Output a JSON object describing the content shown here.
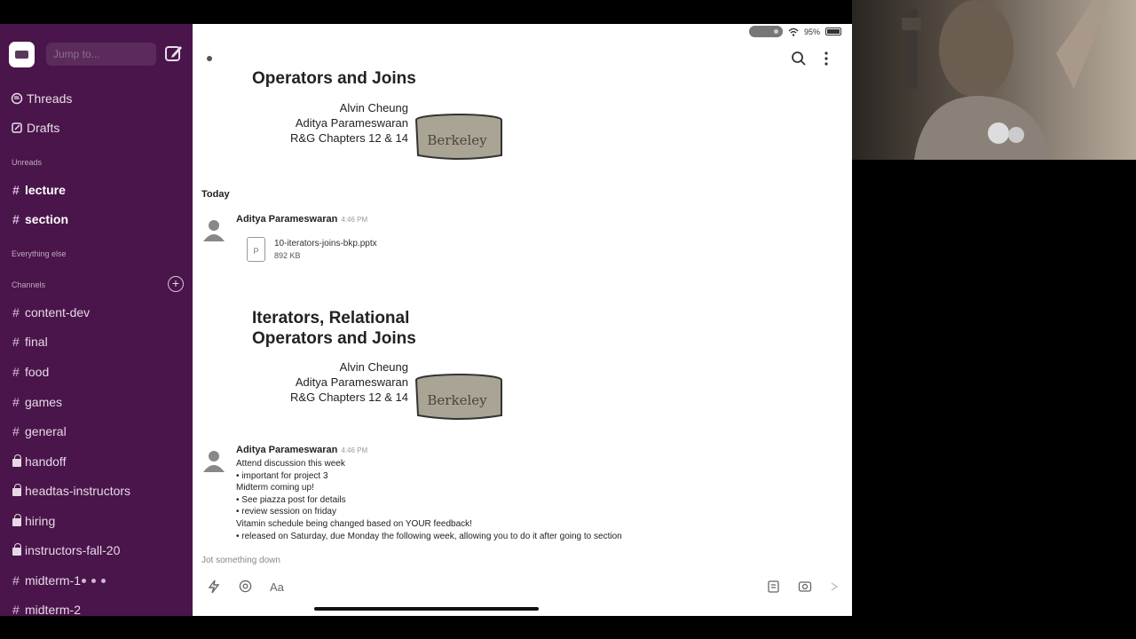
{
  "sidebar": {
    "jump_placeholder": "Jump to...",
    "nav": [
      {
        "label": "Threads"
      },
      {
        "label": "Drafts"
      }
    ],
    "sections": {
      "unreads": "Unreads",
      "everything_else": "Everything else",
      "channels": "Channels"
    },
    "unread_channels": [
      "lecture",
      "section"
    ],
    "channels": [
      {
        "name": "content-dev",
        "private": false
      },
      {
        "name": "final",
        "private": false
      },
      {
        "name": "food",
        "private": false
      },
      {
        "name": "games",
        "private": false
      },
      {
        "name": "general",
        "private": false
      },
      {
        "name": "handoff",
        "private": true
      },
      {
        "name": "headtas-instructors",
        "private": true
      },
      {
        "name": "hiring",
        "private": true
      },
      {
        "name": "instructors-fall-20",
        "private": true
      },
      {
        "name": "midterm-1",
        "private": false
      },
      {
        "name": "midterm-2",
        "private": false
      }
    ]
  },
  "status": {
    "battery": "95%"
  },
  "slide": {
    "title_line1": "Iterators, Relational",
    "title_line2": "Operators and Joins",
    "top_title_partial": "Operators and Joins",
    "author1": "Alvin Cheung",
    "author2": "Aditya Parameswaran",
    "chapters": "R&G Chapters 12 & 14",
    "logo_text": "Berkeley"
  },
  "messages": {
    "day_label": "Today",
    "msg1": {
      "author": "Aditya Parameswaran",
      "time": "4:46 PM",
      "file_name": "10-iterators-joins-bkp.pptx",
      "file_size": "892 KB",
      "file_icon_letter": "P"
    },
    "msg2": {
      "author": "Aditya Parameswaran",
      "time": "4:46 PM",
      "lines": [
        "Attend discussion this week",
        "• important for project 3",
        "Midterm coming up!",
        "• See piazza post for details",
        "• review session on friday",
        "Vitamin schedule being changed based on YOUR feedback!",
        "• released on Saturday, due Monday the following week, allowing you to do it after going to section"
      ]
    }
  },
  "composer": {
    "placeholder": "Jot something down",
    "format_label": "Aa"
  }
}
